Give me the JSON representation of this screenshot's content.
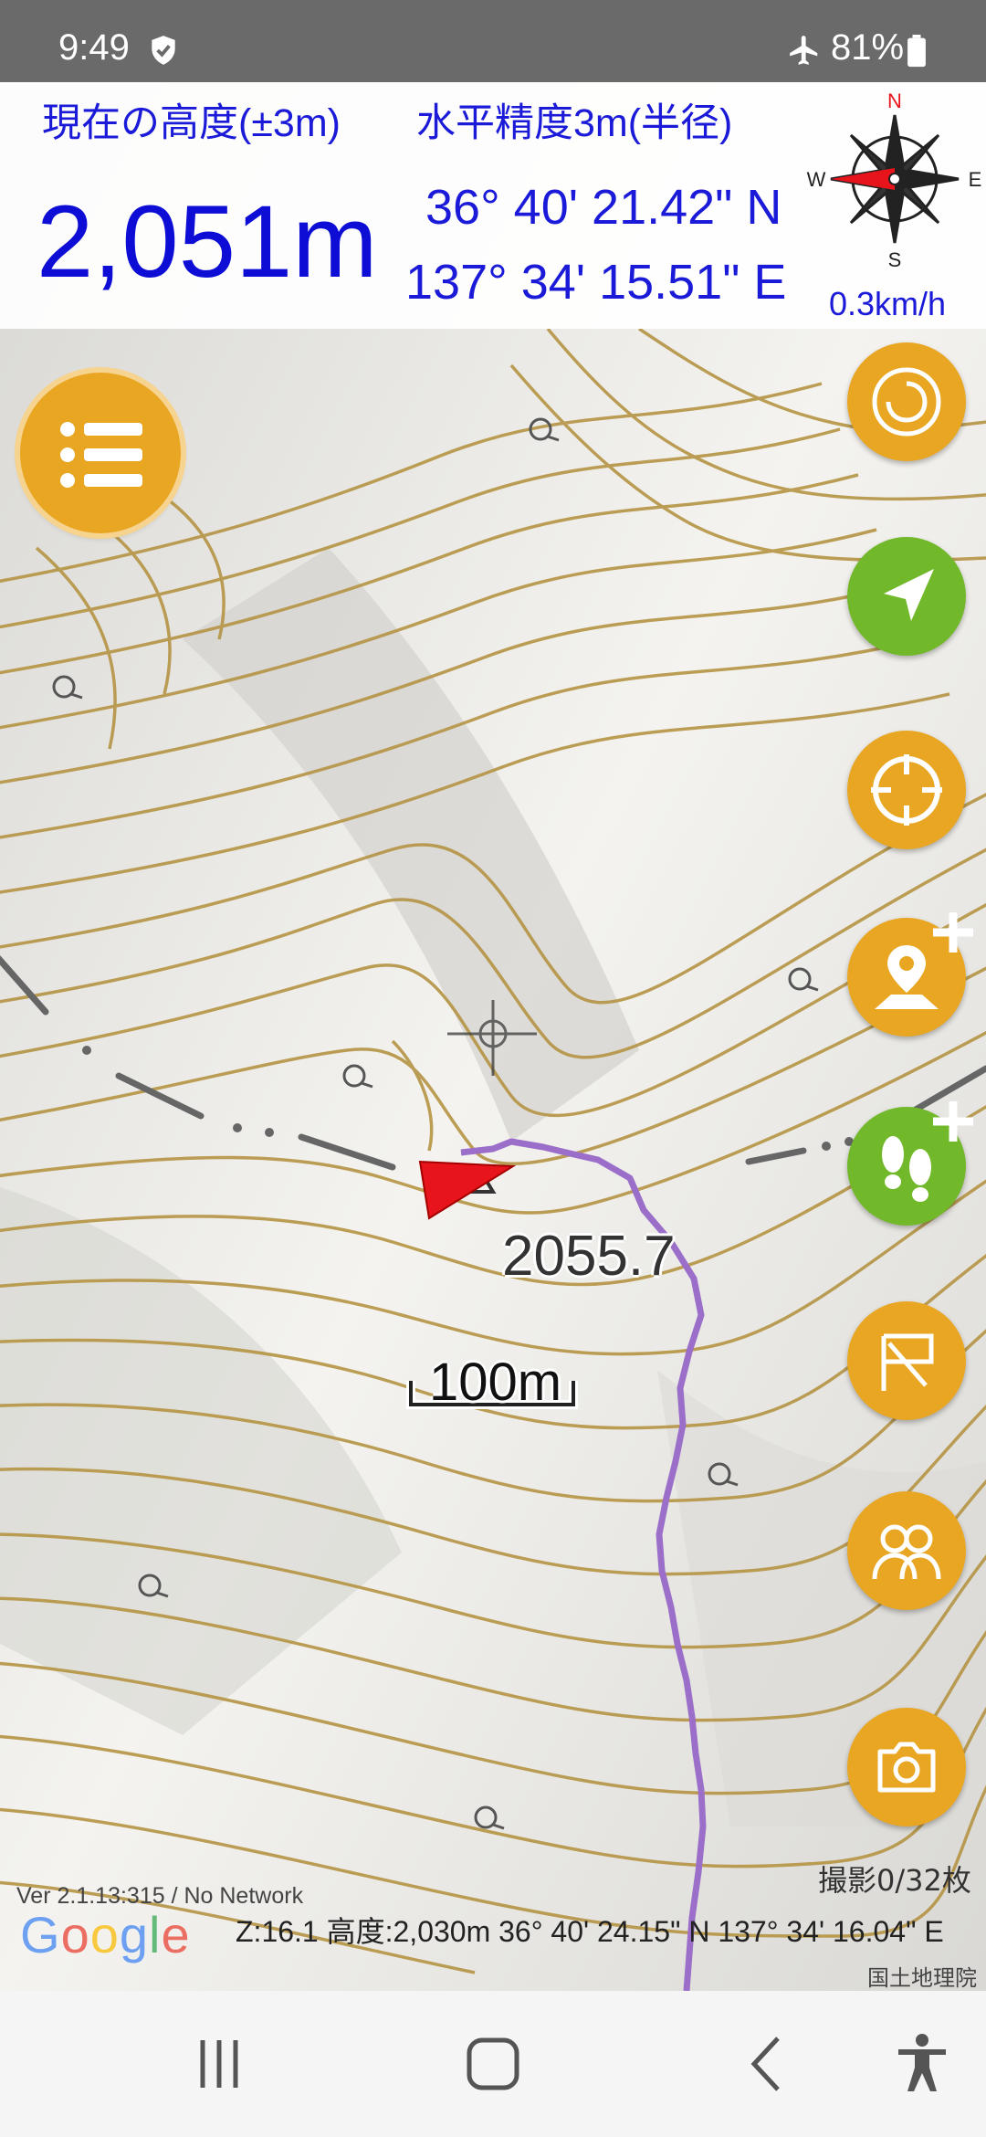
{
  "status_bar": {
    "time": "9:49",
    "battery": "81%",
    "icons": [
      "shield-icon",
      "airplane-mode-icon",
      "battery-icon"
    ]
  },
  "header": {
    "altitude_label": "現在の高度(±3m)",
    "accuracy_label": "水平精度3m(半径)",
    "altitude_value": "2,051m",
    "latitude": "36° 40' 21.42\" N",
    "longitude": "137° 34' 15.51\" E",
    "speed": "0.3km/h",
    "compass": {
      "north": "N",
      "south": "S",
      "east": "E",
      "west": "W"
    }
  },
  "map": {
    "summit_label": "2055.7",
    "scale_label": "100m",
    "version": "Ver 2.1.13:315 / No Network",
    "google_logo": "Google",
    "photo_count": "撮影0/32枚",
    "status_line": "Z:16.1 高度:2,030m  36° 40' 24.15\" N 137° 34' 16.04\" E",
    "attribution": "国土地理院"
  },
  "buttons": [
    {
      "name": "menu-button",
      "icon": "list-icon"
    },
    {
      "name": "map-layer-button",
      "icon": "swirl-icon"
    },
    {
      "name": "my-location-button",
      "icon": "navigation-arrow-icon"
    },
    {
      "name": "compass-button",
      "icon": "crosshair-icon"
    },
    {
      "name": "add-waypoint-button",
      "icon": "add-pin-icon"
    },
    {
      "name": "add-track-button",
      "icon": "add-footprints-icon"
    },
    {
      "name": "route-button",
      "icon": "route-flag-icon"
    },
    {
      "name": "members-button",
      "icon": "people-icon"
    },
    {
      "name": "camera-button",
      "icon": "camera-icon"
    }
  ],
  "nav_bar": [
    "recent-apps-icon",
    "home-icon",
    "back-icon",
    "accessibility-icon"
  ],
  "colors": {
    "accent_orange": "#e9a623",
    "accent_green": "#72b82b",
    "header_text_blue": "#1a1ad8",
    "contour_brown": "#b59444",
    "track_purple": "#9b6fc9",
    "heading_red": "#e8141c"
  }
}
